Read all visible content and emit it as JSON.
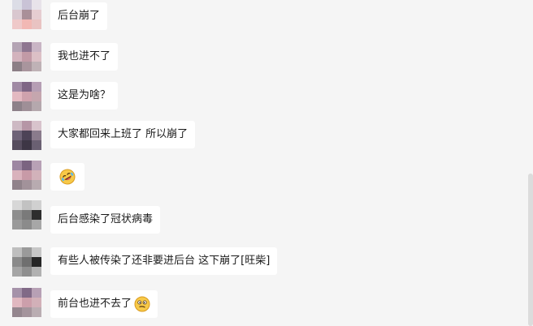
{
  "messages": [
    {
      "text": "后台崩了",
      "emoji": ""
    },
    {
      "text": "我也进不了",
      "emoji": ""
    },
    {
      "text": " 这是为啥？",
      "emoji": ""
    },
    {
      "text": "大家都回来上班了 所以崩了",
      "emoji": ""
    },
    {
      "text": "",
      "emoji": "rofl-emoji-icon"
    },
    {
      "text": "后台感染了冠状病毒",
      "emoji": ""
    },
    {
      "text": "有些人被传染了还非要进后台 这下崩了[旺柴]",
      "emoji": ""
    },
    {
      "text": "前台也进不去了",
      "emoji": "dizzy-face-emoji-icon"
    }
  ],
  "colors": {
    "background": "#f5f5f5",
    "bubble": "#ffffff",
    "text": "#1a1a1a",
    "emoji_yellow": "#f7c948"
  }
}
